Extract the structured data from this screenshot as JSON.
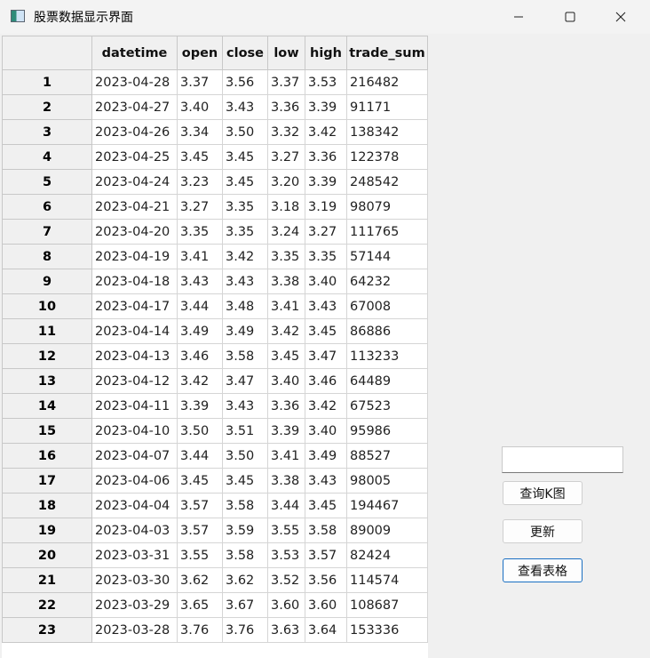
{
  "window": {
    "title": "股票数据显示界面"
  },
  "table": {
    "columns": [
      "datetime",
      "open",
      "close",
      "low",
      "high",
      "trade_sum"
    ],
    "rows": [
      {
        "n": "1",
        "cells": [
          "2023-04-28",
          "3.37",
          "3.56",
          "3.37",
          "3.53",
          "216482"
        ]
      },
      {
        "n": "2",
        "cells": [
          "2023-04-27",
          "3.40",
          "3.43",
          "3.36",
          "3.39",
          "91171"
        ]
      },
      {
        "n": "3",
        "cells": [
          "2023-04-26",
          "3.34",
          "3.50",
          "3.32",
          "3.42",
          "138342"
        ]
      },
      {
        "n": "4",
        "cells": [
          "2023-04-25",
          "3.45",
          "3.45",
          "3.27",
          "3.36",
          "122378"
        ]
      },
      {
        "n": "5",
        "cells": [
          "2023-04-24",
          "3.23",
          "3.45",
          "3.20",
          "3.39",
          "248542"
        ]
      },
      {
        "n": "6",
        "cells": [
          "2023-04-21",
          "3.27",
          "3.35",
          "3.18",
          "3.19",
          "98079"
        ]
      },
      {
        "n": "7",
        "cells": [
          "2023-04-20",
          "3.35",
          "3.35",
          "3.24",
          "3.27",
          "111765"
        ]
      },
      {
        "n": "8",
        "cells": [
          "2023-04-19",
          "3.41",
          "3.42",
          "3.35",
          "3.35",
          "57144"
        ]
      },
      {
        "n": "9",
        "cells": [
          "2023-04-18",
          "3.43",
          "3.43",
          "3.38",
          "3.40",
          "64232"
        ]
      },
      {
        "n": "10",
        "cells": [
          "2023-04-17",
          "3.44",
          "3.48",
          "3.41",
          "3.43",
          "67008"
        ]
      },
      {
        "n": "11",
        "cells": [
          "2023-04-14",
          "3.49",
          "3.49",
          "3.42",
          "3.45",
          "86886"
        ]
      },
      {
        "n": "12",
        "cells": [
          "2023-04-13",
          "3.46",
          "3.58",
          "3.45",
          "3.47",
          "113233"
        ]
      },
      {
        "n": "13",
        "cells": [
          "2023-04-12",
          "3.42",
          "3.47",
          "3.40",
          "3.46",
          "64489"
        ]
      },
      {
        "n": "14",
        "cells": [
          "2023-04-11",
          "3.39",
          "3.43",
          "3.36",
          "3.42",
          "67523"
        ]
      },
      {
        "n": "15",
        "cells": [
          "2023-04-10",
          "3.50",
          "3.51",
          "3.39",
          "3.40",
          "95986"
        ]
      },
      {
        "n": "16",
        "cells": [
          "2023-04-07",
          "3.44",
          "3.50",
          "3.41",
          "3.49",
          "88527"
        ]
      },
      {
        "n": "17",
        "cells": [
          "2023-04-06",
          "3.45",
          "3.45",
          "3.38",
          "3.43",
          "98005"
        ]
      },
      {
        "n": "18",
        "cells": [
          "2023-04-04",
          "3.57",
          "3.58",
          "3.44",
          "3.45",
          "194467"
        ]
      },
      {
        "n": "19",
        "cells": [
          "2023-04-03",
          "3.57",
          "3.59",
          "3.55",
          "3.58",
          "89009"
        ]
      },
      {
        "n": "20",
        "cells": [
          "2023-03-31",
          "3.55",
          "3.58",
          "3.53",
          "3.57",
          "82424"
        ]
      },
      {
        "n": "21",
        "cells": [
          "2023-03-30",
          "3.62",
          "3.62",
          "3.52",
          "3.56",
          "114574"
        ]
      },
      {
        "n": "22",
        "cells": [
          "2023-03-29",
          "3.65",
          "3.67",
          "3.60",
          "3.60",
          "108687"
        ]
      },
      {
        "n": "23",
        "cells": [
          "2023-03-28",
          "3.76",
          "3.76",
          "3.63",
          "3.64",
          "153336"
        ]
      }
    ]
  },
  "controls": {
    "input_value": "",
    "query_kline_label": "查询K图",
    "update_label": "更新",
    "view_table_label": "查看表格"
  }
}
